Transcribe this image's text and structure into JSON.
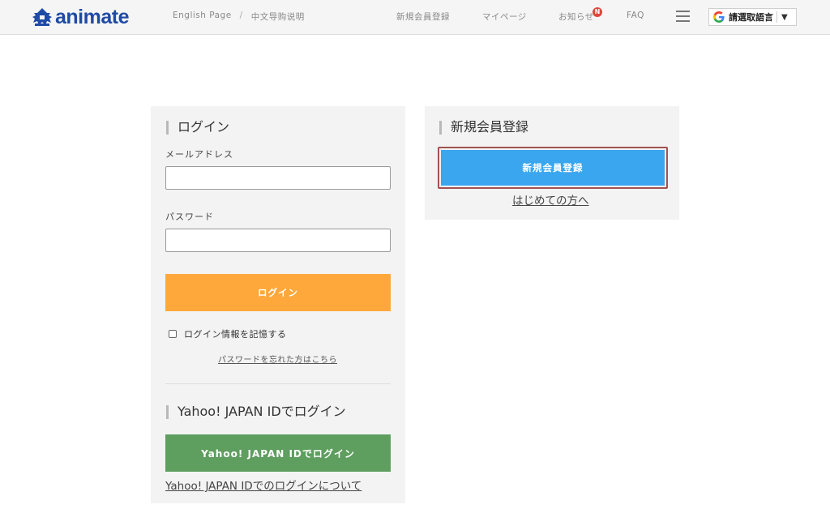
{
  "header": {
    "logo_text": "animate",
    "links": {
      "english": "English Page",
      "separator": "/",
      "chinese": "中文导购说明"
    },
    "nav": {
      "register": "新規会員登録",
      "mypage": "マイページ",
      "news": "お知らせ",
      "news_badge": "N",
      "faq": "FAQ"
    },
    "translate": {
      "label": "請選取語言",
      "arrow": "▼"
    },
    "colors": {
      "brand": "#1f4aa5",
      "badge": "#e0463a"
    },
    "icons": {
      "logo": "castle-logo-icon",
      "menu": "hamburger-menu-icon",
      "google": "google-g-icon",
      "dropdown": "triangle-down-icon"
    }
  },
  "login": {
    "title": "ログイン",
    "email_label": "メールアドレス",
    "email_value": "",
    "password_label": "パスワード",
    "password_value": "",
    "submit_label": "ログイン",
    "remember_label": "ログイン情報を記憶する",
    "remember_checked": false,
    "forgot_link": "パスワードを忘れた方はこちら",
    "colors": {
      "submit": "#fea83b"
    }
  },
  "yahoo": {
    "title": "Yahoo! JAPAN IDでログイン",
    "button_label": "Yahoo! JAPAN IDでログイン",
    "about_link": "Yahoo! JAPAN IDでのログインについて",
    "colors": {
      "button": "#5e9e5f"
    }
  },
  "signup": {
    "title": "新規会員登録",
    "button_label": "新規会員登録",
    "first_time_link": "はじめての方へ",
    "colors": {
      "button": "#3aa6ef",
      "highlight": "#a0524f"
    }
  }
}
